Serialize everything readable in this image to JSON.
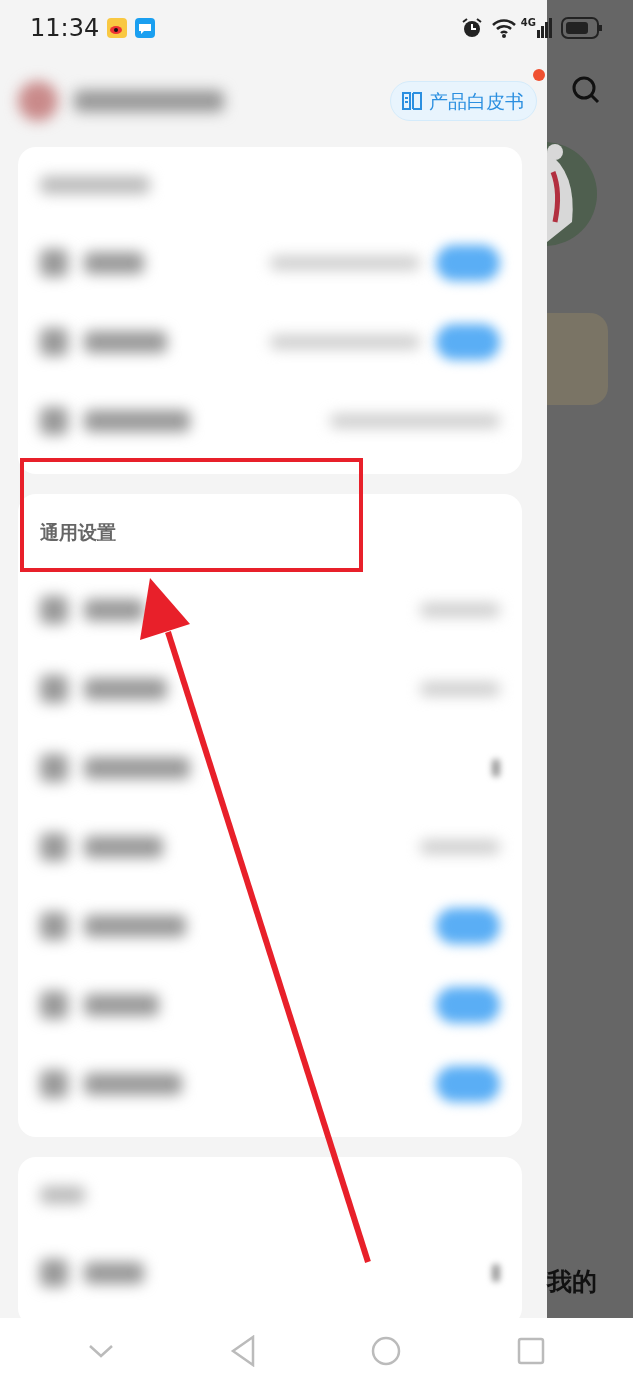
{
  "status_bar": {
    "time": "11:34",
    "network": "4G"
  },
  "drawer": {
    "whitepaper_button": {
      "label": "产品白皮书",
      "badge": true
    },
    "cards": [
      {
        "rows": [
          {
            "kind": "toggle",
            "on": true
          },
          {
            "kind": "toggle",
            "on": true
          },
          {
            "kind": "value"
          }
        ]
      },
      {
        "title": "通用设置",
        "rows": [
          {
            "kind": "value"
          },
          {
            "kind": "value"
          },
          {
            "kind": "chevron"
          },
          {
            "kind": "value"
          },
          {
            "kind": "toggle",
            "on": true
          },
          {
            "kind": "toggle",
            "on": true
          },
          {
            "kind": "toggle",
            "on": true
          }
        ]
      },
      {
        "rows": [
          {
            "kind": "chevron"
          }
        ]
      }
    ]
  },
  "background_page": {
    "tab_label": "我的"
  }
}
